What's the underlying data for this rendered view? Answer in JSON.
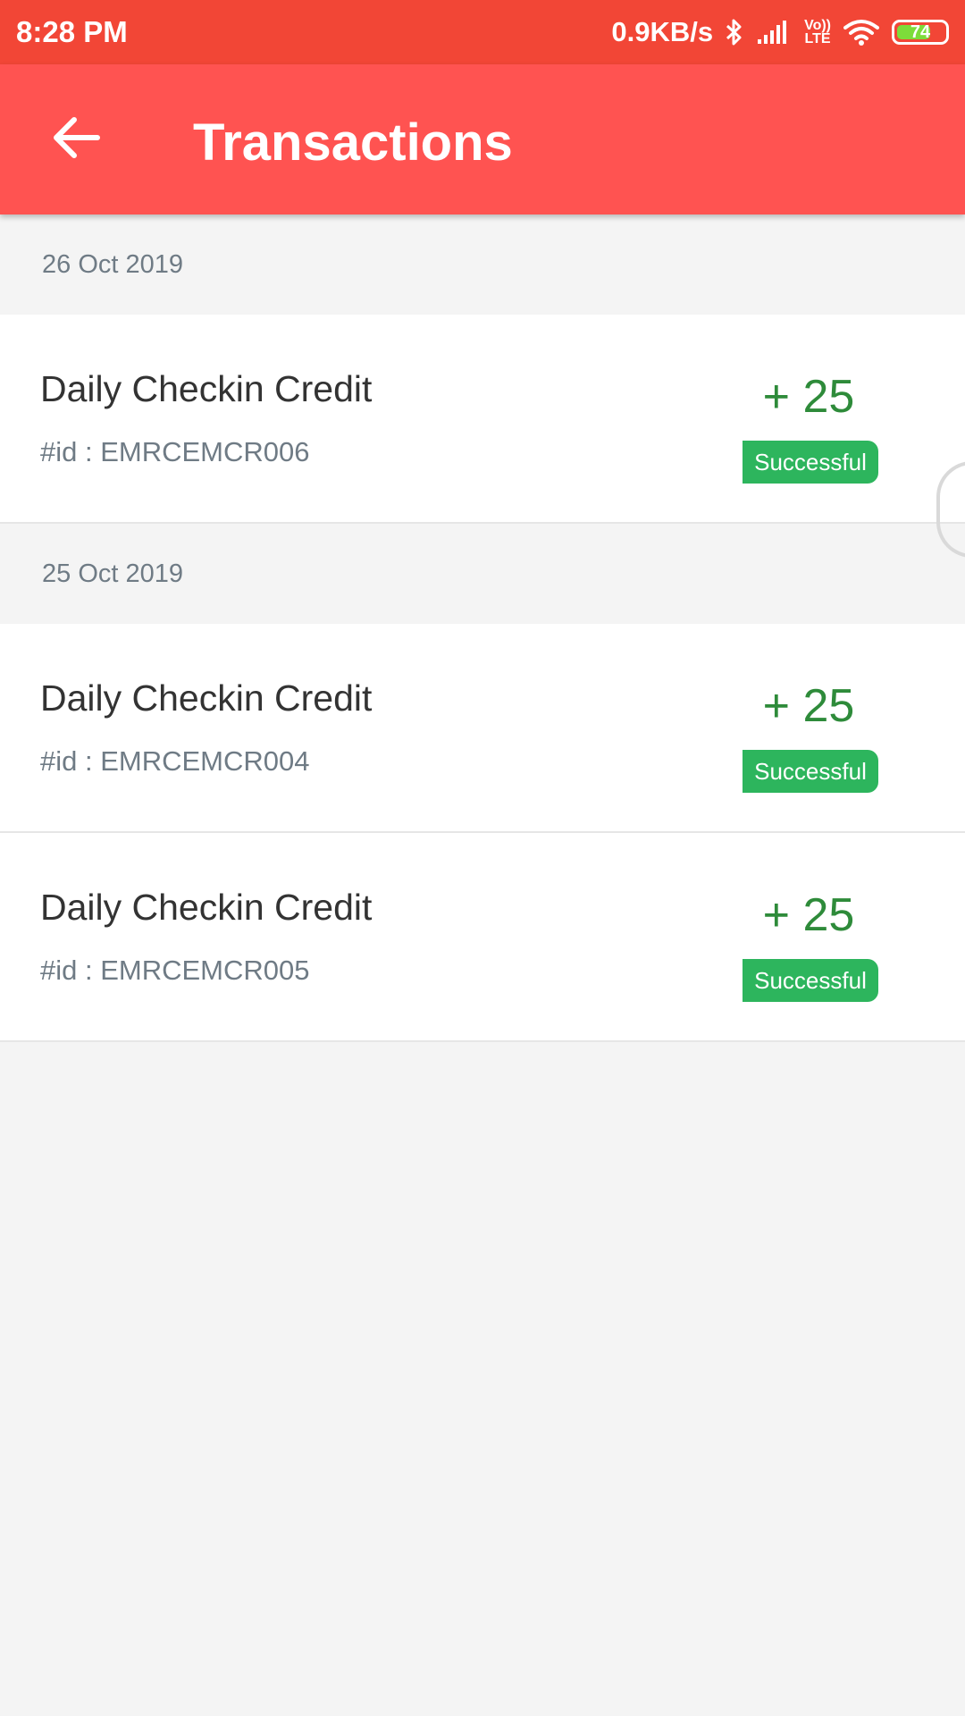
{
  "status_bar": {
    "time": "8:28 PM",
    "network_speed": "0.9KB/s",
    "volte_line1": "Vo))",
    "volte_line2": "LTE",
    "battery_level": "74",
    "battery_fraction": 0.74,
    "icons": [
      "bluetooth-icon",
      "signal-icon",
      "volte-icon",
      "wifi-icon",
      "battery-icon"
    ]
  },
  "app_bar": {
    "title": "Transactions",
    "back_icon": "arrow-left-icon",
    "color": "#ff5351"
  },
  "groups": [
    {
      "date": "26 Oct 2019",
      "transactions": [
        {
          "title": "Daily Checkin Credit",
          "id": "#id : EMRCEMCR006",
          "amount": "+ 25",
          "status": "Successful"
        }
      ]
    },
    {
      "date": "25 Oct 2019",
      "transactions": [
        {
          "title": "Daily Checkin Credit",
          "id": "#id : EMRCEMCR004",
          "amount": "+ 25",
          "status": "Successful"
        },
        {
          "title": "Daily Checkin Credit",
          "id": "#id : EMRCEMCR005",
          "amount": "+ 25",
          "status": "Successful"
        }
      ]
    }
  ],
  "colors": {
    "status_bar": "#f24636",
    "amount": "#2e8b3a",
    "success_badge": "#2db55d"
  }
}
